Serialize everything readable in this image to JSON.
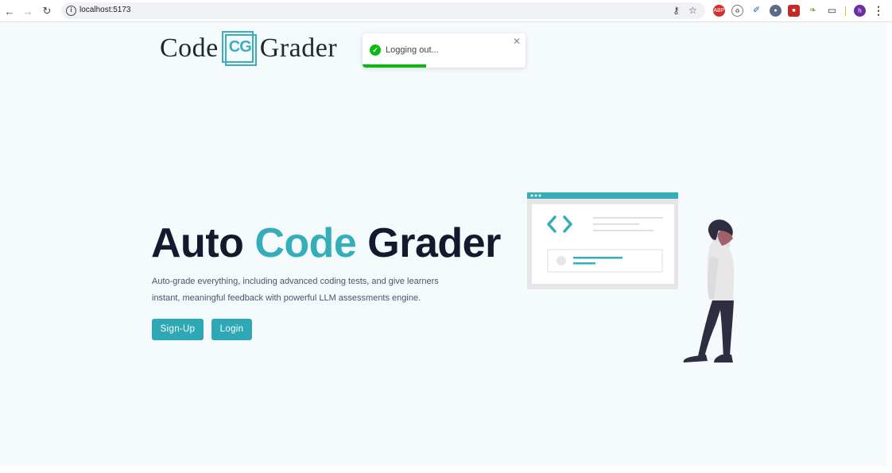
{
  "browser": {
    "url": "localhost:5173",
    "profile_initial": "h"
  },
  "header": {
    "logo_left": "Code",
    "logo_initials": "CG",
    "logo_right": "Grader"
  },
  "toast": {
    "message": "Logging out...",
    "progress": 0.39,
    "color": "#07bc0c"
  },
  "hero": {
    "title_part1": "Auto ",
    "title_accent": "Code",
    "title_part2": " Grader",
    "description": "Auto-grade everything, including advanced coding tests, and give learners instant, meaningful feedback with powerful LLM assessments engine.",
    "signup_label": "Sign-Up",
    "login_label": "Login"
  },
  "colors": {
    "accent": "#35aeba",
    "button": "#2ea8b4",
    "title": "#141a2e",
    "background": "#f5fafd"
  }
}
